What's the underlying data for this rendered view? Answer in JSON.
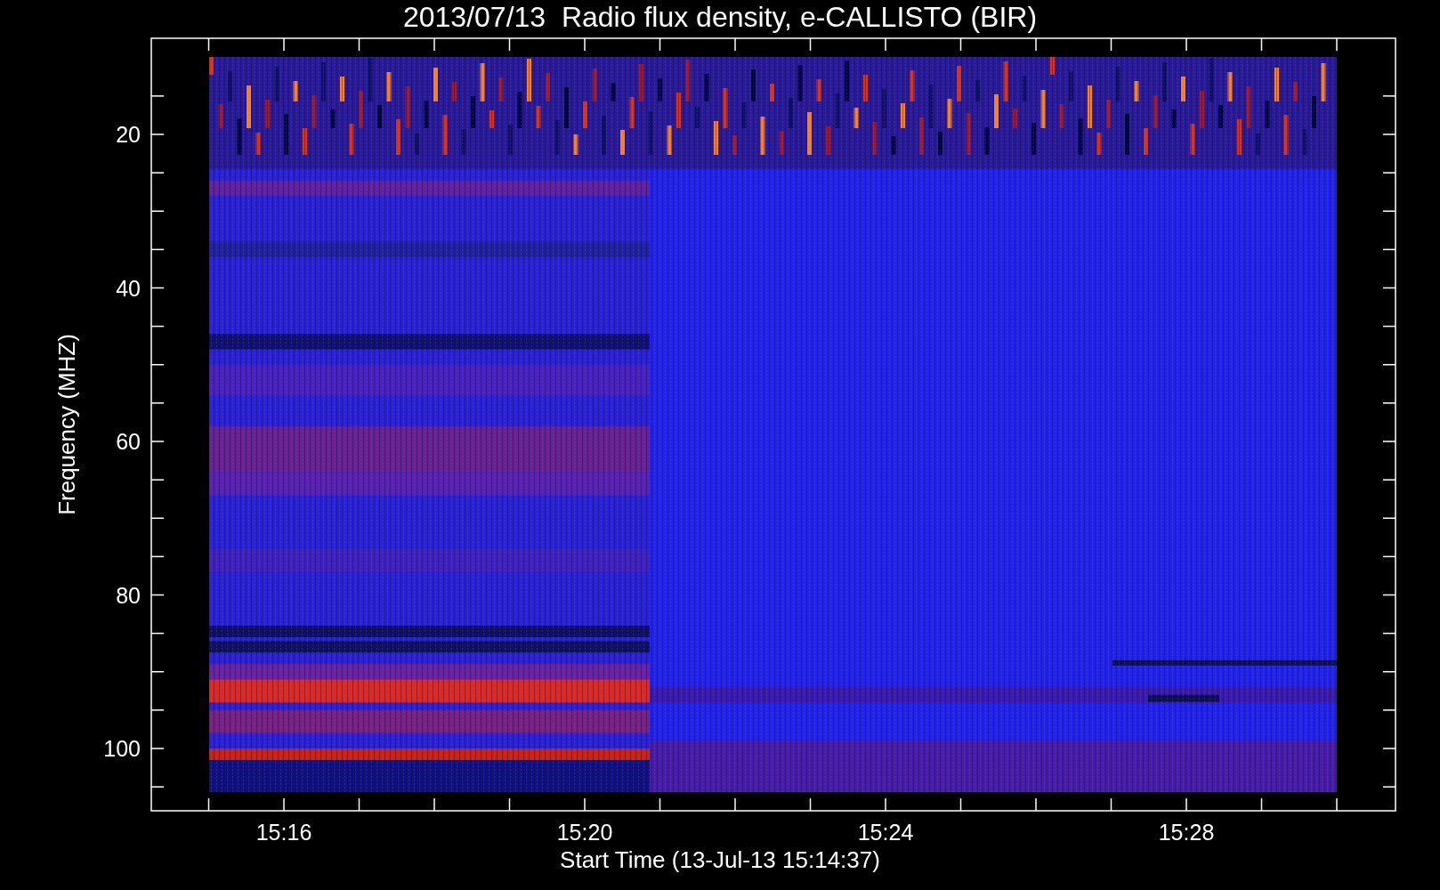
{
  "title": "2013/07/13  Radio flux density, e-CALLISTO (BIR)",
  "y_axis": {
    "label": "Frequency (MHZ)",
    "ticks": [
      "20",
      "40",
      "60",
      "80",
      "100"
    ]
  },
  "x_axis": {
    "label": "Start Time (13-Jul-13 15:14:37)",
    "ticks": [
      "15:16",
      "15:20",
      "15:24",
      "15:28"
    ]
  }
}
